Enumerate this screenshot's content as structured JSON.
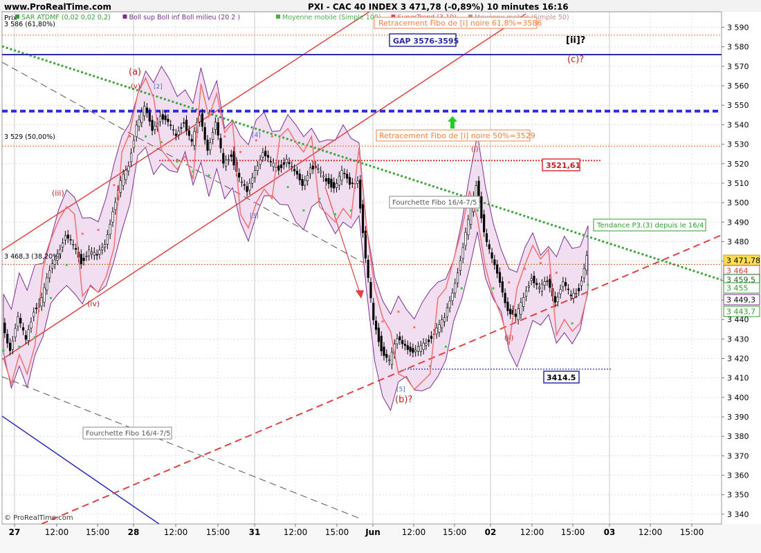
{
  "header": {
    "site": "www.ProRealTime.com",
    "title": "PXI - CAC 40 INDEX   3 471,78  (-0,89%)    10 minutes  16:16",
    "prix": "Prix"
  },
  "legend_items": [
    {
      "text": "SAR ATDMF (0,02 0,02 0,2)",
      "color": "#35a035"
    },
    {
      "text": "Boll sup Boll inf Boll milieu (20 2 )",
      "color": "#7b2f8f"
    },
    {
      "text": "Moyenne mobile (Simple 100)",
      "color": "#4caf50"
    },
    {
      "text": "SuperTrend (3 10)",
      "color": "#e05050"
    },
    {
      "text": "Moyenne mobile (Simple 50)",
      "color": "#c09090"
    }
  ],
  "fibo_labels": {
    "f618": "3 586 (61,80%)",
    "f50": "3 529 (50,00%)",
    "f382": "3 468,3 (38,20%)"
  },
  "boxes": {
    "retr_618": "Retracement Fibo de [i] noire 61,8%=3586",
    "gap": "GAP 3576-3595",
    "retr_50": "Retracement Fibo de [i] noire 50%=3529",
    "level_3521": "3521,61",
    "level_3414": "3414.5",
    "tendance": "Tendance P3.(3) depuis le 16/4",
    "fourchette1": "Fourchette Fibo 16/4-7/5",
    "fourchette2": "Fourchette Fibo 16/4-7/5"
  },
  "waves": {
    "a": "(a)",
    "b": "(b)?",
    "c": "(c)?",
    "ii_big": "[ii]?",
    "iii": "(iii)",
    "iv": "(iv)",
    "ii_small": "(ii)",
    "i_small": "(i)",
    "v": "(v)",
    "w2": "[2]",
    "w3": "[3]",
    "w4": "[4]",
    "w5": "[5]"
  },
  "price_tags": [
    {
      "label": "3 471,78",
      "bg": "#ffdd55",
      "fg": "#000000",
      "border": "#c8a000"
    },
    {
      "label": "3 464",
      "bg": "#ffffff",
      "fg": "#d04040",
      "border": "#d04040"
    },
    {
      "label": "3 459,5",
      "bg": "#ffffff",
      "fg": "#1b5e20",
      "border": "#1b5e20"
    },
    {
      "label": "3 455",
      "bg": "#ffffff",
      "fg": "#2e9e2e",
      "border": "#2e9e2e"
    },
    {
      "label": "3 449,3",
      "bg": "#ffffff",
      "fg": "#000000",
      "border": "#7b2f8f"
    },
    {
      "label": "3 443,7",
      "bg": "#ffffff",
      "fg": "#2e9e2e",
      "border": "#2e9e2e"
    }
  ],
  "copyright": "© ProRealTime.com",
  "chart_data": {
    "type": "candlestick",
    "title": "PXI - CAC 40 INDEX   3 471,78  (-0,89%)    10 minutes  16:16",
    "ylabel": "Prix",
    "ylim": [
      3335,
      3600
    ],
    "y_ticks": [
      3340,
      3350,
      3360,
      3370,
      3380,
      3390,
      3400,
      3410,
      3420,
      3430,
      3440,
      3450,
      3460,
      3470,
      3480,
      3490,
      3500,
      3510,
      3520,
      3530,
      3540,
      3550,
      3560,
      3570,
      3580,
      3590
    ],
    "y_tick_labels": [
      "3 340",
      "3 350",
      "3 360",
      "3 370",
      "3 380",
      "3 390",
      "3 400",
      "3 410",
      "3 420",
      "3 430",
      "3 440",
      "3 450",
      "3 460",
      "3 470",
      "3 480",
      "3 490",
      "3 500",
      "3 510",
      "3 520",
      "3 530",
      "3 540",
      "3 550",
      "3 560",
      "3 570",
      "3 580",
      "3 590"
    ],
    "x_ticks": [
      "27",
      "12:00",
      "15:00",
      "28",
      "12:00",
      "15:00",
      "31",
      "12:00",
      "15:00",
      "Jun",
      "12:00",
      "15:00",
      "02",
      "12:00",
      "15:00",
      "03",
      "12:00",
      "15:00"
    ],
    "bold_x_ticks": [
      "27",
      "28",
      "31",
      "Jun",
      "02",
      "03"
    ],
    "horizontal_levels": [
      {
        "value": 3586,
        "style": "dotted",
        "color": "#f08040"
      },
      {
        "value": 3576,
        "style": "solid",
        "color": "#2a2aa8"
      },
      {
        "value": 3547,
        "style": "dashed-thick",
        "color": "#2a2ae0"
      },
      {
        "value": 3529,
        "style": "dotted",
        "color": "#f08040"
      },
      {
        "value": 3521.61,
        "style": "dotted",
        "color": "#e03030"
      },
      {
        "value": 3468.3,
        "style": "dotted",
        "color": "#c07040"
      },
      {
        "value": 3414.5,
        "style": "dotted",
        "color": "#2a2aa8"
      }
    ],
    "price_path": [
      [
        0,
        3438
      ],
      [
        1,
        3425
      ],
      [
        2,
        3440
      ],
      [
        3,
        3430
      ],
      [
        4,
        3445
      ],
      [
        5,
        3450
      ],
      [
        6,
        3465
      ],
      [
        7,
        3475
      ],
      [
        8,
        3482
      ],
      [
        9,
        3478
      ],
      [
        10,
        3470
      ],
      [
        11,
        3475
      ],
      [
        12,
        3472
      ],
      [
        13,
        3480
      ],
      [
        14,
        3495
      ],
      [
        15,
        3510
      ],
      [
        16,
        3520
      ],
      [
        17,
        3540
      ],
      [
        18,
        3548
      ],
      [
        19,
        3538
      ],
      [
        20,
        3545
      ],
      [
        21,
        3540
      ],
      [
        22,
        3535
      ],
      [
        23,
        3542
      ],
      [
        24,
        3530
      ],
      [
        25,
        3545
      ],
      [
        26,
        3528
      ],
      [
        27,
        3540
      ],
      [
        28,
        3520
      ],
      [
        29,
        3525
      ],
      [
        30,
        3512
      ],
      [
        31,
        3505
      ],
      [
        32,
        3518
      ],
      [
        33,
        3525
      ],
      [
        34,
        3520
      ],
      [
        35,
        3518
      ],
      [
        36,
        3522
      ],
      [
        37,
        3515
      ],
      [
        38,
        3510
      ],
      [
        39,
        3518
      ],
      [
        40,
        3516
      ],
      [
        41,
        3512
      ],
      [
        42,
        3508
      ],
      [
        43,
        3515
      ],
      [
        44,
        3510
      ],
      [
        45,
        3512
      ],
      [
        46,
        3470
      ],
      [
        47,
        3440
      ],
      [
        48,
        3425
      ],
      [
        49,
        3418
      ],
      [
        50,
        3430
      ],
      [
        51,
        3428
      ],
      [
        52,
        3422
      ],
      [
        53,
        3426
      ],
      [
        54,
        3430
      ],
      [
        55,
        3435
      ],
      [
        56,
        3440
      ],
      [
        57,
        3455
      ],
      [
        58,
        3470
      ],
      [
        59,
        3490
      ],
      [
        60,
        3510
      ],
      [
        61,
        3485
      ],
      [
        62,
        3470
      ],
      [
        63,
        3460
      ],
      [
        64,
        3445
      ],
      [
        65,
        3440
      ],
      [
        66,
        3452
      ],
      [
        67,
        3462
      ],
      [
        68,
        3455
      ],
      [
        69,
        3460
      ],
      [
        70,
        3450
      ],
      [
        71,
        3458
      ],
      [
        72,
        3452
      ],
      [
        73,
        3456
      ],
      [
        74,
        3471.78
      ]
    ],
    "x_data_range": [
      0,
      100
    ]
  }
}
